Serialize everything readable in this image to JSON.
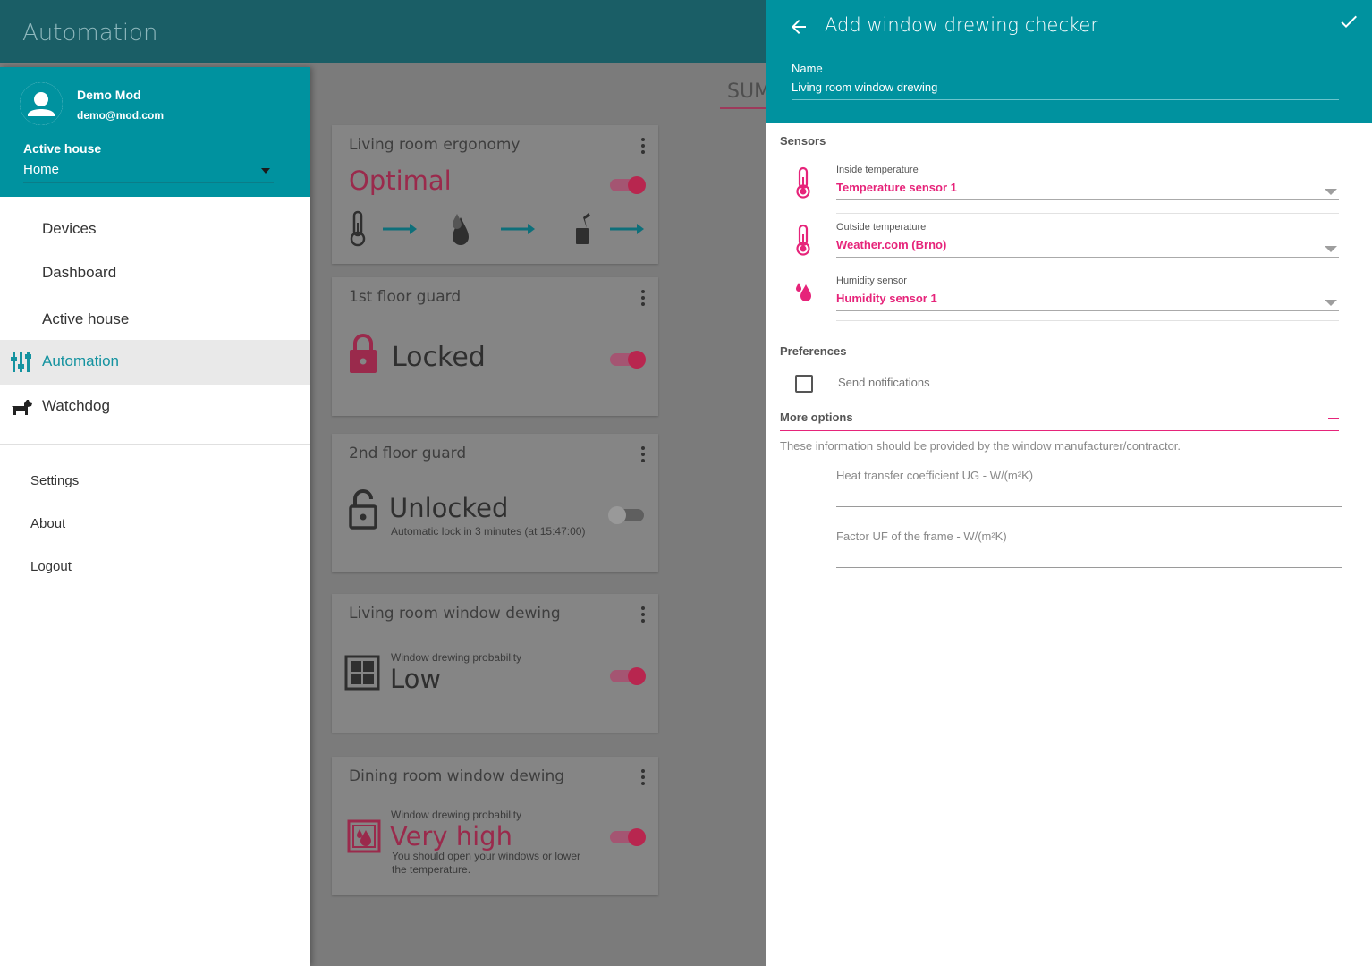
{
  "app": {
    "title": "Automation"
  },
  "main": {
    "tab_label": "SUM",
    "cards": [
      {
        "title": "Living room ergonomy",
        "status": "Optimal",
        "enabled": true
      },
      {
        "title": "1st floor guard",
        "status": "Locked",
        "enabled": true
      },
      {
        "title": "2nd floor guard",
        "status": "Unlocked",
        "detail": "Automatic lock in 3 minutes (at 15:47:00)",
        "enabled": false
      },
      {
        "title": "Living room window dewing",
        "caption": "Window drewing probability",
        "status": "Low",
        "enabled": true
      },
      {
        "title": "Dining room window dewing",
        "caption": "Window drewing probability",
        "status": "Very high",
        "detail_line1": "You should open your windows or lower",
        "detail_line2": "the temperature.",
        "enabled": true
      }
    ]
  },
  "drawer": {
    "user": {
      "name": "Demo Mod",
      "email": "demo@mod.com"
    },
    "active_house_label": "Active house",
    "active_house_value": "Home",
    "nav": [
      {
        "label": "Devices"
      },
      {
        "label": "Dashboard"
      },
      {
        "label": "Active house"
      },
      {
        "label": "Automation",
        "active": true
      },
      {
        "label": "Watchdog"
      }
    ],
    "secondary": [
      {
        "label": "Settings"
      },
      {
        "label": "About"
      },
      {
        "label": "Logout"
      }
    ]
  },
  "panel": {
    "title": "Add window drewing checker",
    "name_label": "Name",
    "name_value": "Living room window drewing",
    "sensors_title": "Sensors",
    "sensors": [
      {
        "label": "Inside temperature",
        "value": "Temperature sensor 1",
        "icon": "thermometer-icon"
      },
      {
        "label": "Outside temperature",
        "value": "Weather.com (Brno)",
        "icon": "thermometer-icon"
      },
      {
        "label": "Humidity sensor",
        "value": "Humidity sensor 1",
        "icon": "humidity-icon"
      }
    ],
    "preferences_title": "Preferences",
    "send_notifications_label": "Send notifications",
    "send_notifications_checked": false,
    "more_options_label": "More options",
    "info_text": "These information should be provided by the window manufacturer/contractor.",
    "fields": [
      {
        "label": "Heat transfer coefficient UG - W/(m²K)",
        "value": ""
      },
      {
        "label": "Factor UF of the frame - W/(m²K)",
        "value": ""
      }
    ]
  },
  "colors": {
    "teal": "#00929f",
    "dark_teal": "#1a5e66",
    "accent_pink": "#e6247a"
  }
}
